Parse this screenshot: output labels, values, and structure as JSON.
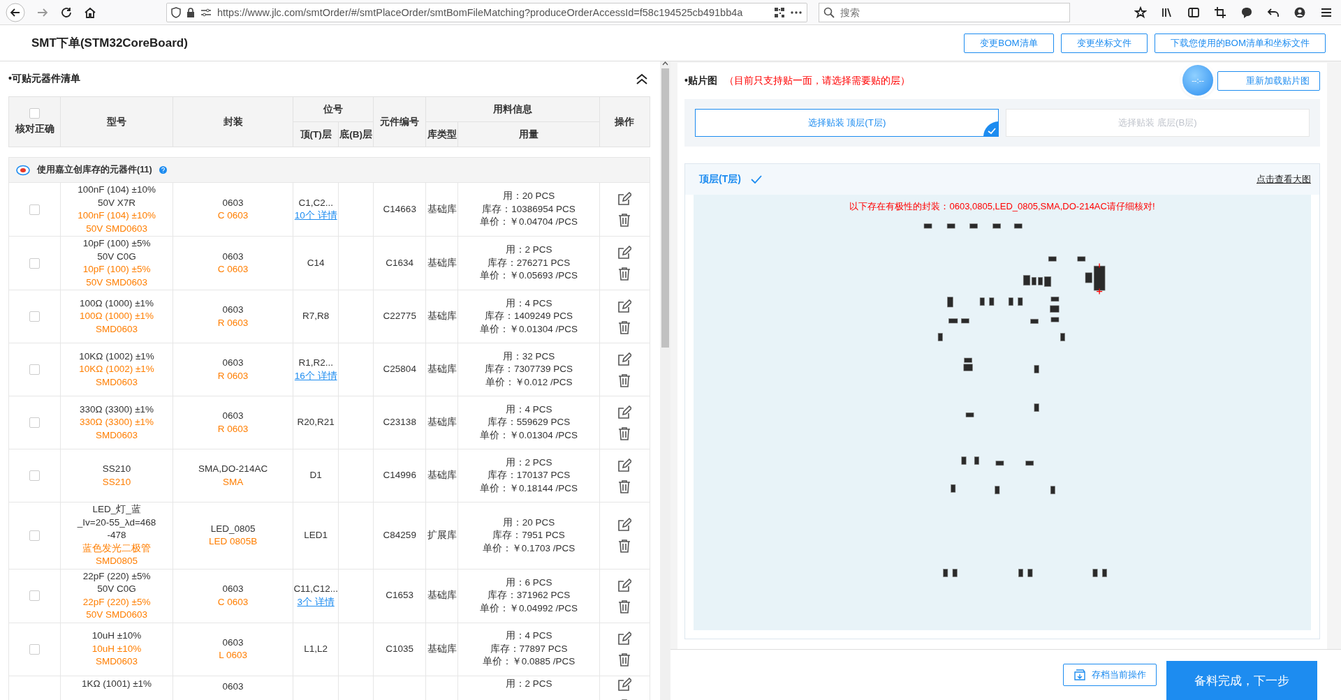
{
  "browser": {
    "url": "https://www.jlc.com/smtOrder/#/smtPlaceOrder/smtBomFileMatching?produceOrderAccessId=f58c194525cb491bb4a",
    "search": {
      "placeholder": "搜索"
    }
  },
  "header": {
    "title": "SMT下单(STM32CoreBoard)",
    "buttons": [
      "变更BOM清单",
      "变更坐标文件",
      "下载您使用的BOM清单和坐标文件"
    ]
  },
  "bom_panel": {
    "title": "•可贴元器件清单",
    "columns": {
      "check": "核对正确",
      "model": "型号",
      "package": "封装",
      "designator": "位号",
      "top": "顶(T)层",
      "bottom": "底(B)层",
      "part_number": "元件编号",
      "material": "用料信息",
      "library": "库类型",
      "usage": "用量",
      "actions": "操作"
    },
    "select_all": {
      "checked": false
    },
    "group": {
      "label": "使用嘉立创库存的元器件(11)"
    },
    "rows": [
      {
        "checked": false,
        "model": [
          "100nF (104) ±10%",
          "50V X7R"
        ],
        "model_match": [
          "100nF (104) ±10%",
          "50V SMD0603"
        ],
        "package": "0603",
        "package_match": "C 0603",
        "top": "C1,C2...",
        "detail": "10个 详情",
        "part_number": "C14663",
        "library": "基础库",
        "usage": "用：20 PCS",
        "stock": "库存：10386954 PCS",
        "price": "单价：￥0.04704 /PCS"
      },
      {
        "checked": false,
        "model": [
          "10pF (100) ±5%",
          "50V C0G"
        ],
        "model_match": [
          "10pF (100) ±5%",
          "50V SMD0603"
        ],
        "package": "0603",
        "package_match": "C 0603",
        "top": "C14",
        "part_number": "C1634",
        "library": "基础库",
        "usage": "用：2 PCS",
        "stock": "库存：276271 PCS",
        "price": "单价：￥0.05693 /PCS"
      },
      {
        "checked": false,
        "model": [
          "100Ω (1000) ±1%"
        ],
        "model_match": [
          "100Ω (1000) ±1%",
          "SMD0603"
        ],
        "package": "0603",
        "package_match": "R 0603",
        "top": "R7,R8",
        "part_number": "C22775",
        "library": "基础库",
        "usage": "用：4 PCS",
        "stock": "库存：1409249 PCS",
        "price": "单价：￥0.01304 /PCS"
      },
      {
        "checked": false,
        "model": [
          "10KΩ (1002) ±1%"
        ],
        "model_match": [
          "10KΩ (1002) ±1%",
          "SMD0603"
        ],
        "package": "0603",
        "package_match": "R 0603",
        "top": "R1,R2...",
        "detail": "16个 详情",
        "part_number": "C25804",
        "library": "基础库",
        "usage": "用：32 PCS",
        "stock": "库存：7307739 PCS",
        "price": "单价：￥0.012 /PCS"
      },
      {
        "checked": false,
        "model": [
          "330Ω (3300) ±1%"
        ],
        "model_match": [
          "330Ω (3300) ±1%",
          "SMD0603"
        ],
        "package": "0603",
        "package_match": "R 0603",
        "top": "R20,R21",
        "part_number": "C23138",
        "library": "基础库",
        "usage": "用：4 PCS",
        "stock": "库存：559629 PCS",
        "price": "单价：￥0.01304 /PCS"
      },
      {
        "checked": false,
        "model": [
          "SS210"
        ],
        "model_match": [
          "SS210"
        ],
        "package": "SMA,DO-214AC",
        "package_match": "SMA",
        "top": "D1",
        "part_number": "C14996",
        "library": "基础库",
        "usage": "用：2 PCS",
        "stock": "库存：170137 PCS",
        "price": "单价：￥0.18144 /PCS"
      },
      {
        "checked": false,
        "model": [
          "LED_灯_蓝",
          "_Iv=20-55_λd=468",
          "-478"
        ],
        "model_match": [
          "蓝色发光二极管",
          "SMD0805"
        ],
        "package": "LED_0805",
        "package_match": "LED 0805B",
        "top": "LED1",
        "part_number": "C84259",
        "library": "扩展库",
        "usage": "用：20 PCS",
        "stock": "库存：7951 PCS",
        "price": "单价：￥0.1703 /PCS"
      },
      {
        "checked": false,
        "model": [
          "22pF (220) ±5%",
          "50V C0G"
        ],
        "model_match": [
          "22pF (220) ±5%",
          "50V SMD0603"
        ],
        "package": "0603",
        "package_match": "C 0603",
        "top": "C11,C12...",
        "detail": "3个 详情",
        "part_number": "C1653",
        "library": "基础库",
        "usage": "用：6 PCS",
        "stock": "库存：371962 PCS",
        "price": "单价：￥0.04992 /PCS"
      },
      {
        "checked": false,
        "model": [
          "10uH ±10%"
        ],
        "model_match": [
          "10uH ±10%",
          "SMD0603"
        ],
        "package": "0603",
        "package_match": "L 0603",
        "top": "L1,L2",
        "part_number": "C1035",
        "library": "基础库",
        "usage": "用：4 PCS",
        "stock": "库存：77897 PCS",
        "price": "单价：￥0.0885 /PCS"
      },
      {
        "model": [
          "1KΩ (1001) ±1%"
        ],
        "package": "0603",
        "usage": "用：2 PCS"
      }
    ]
  },
  "placement_panel": {
    "title": "•贴片图",
    "note": "（目前只支持贴一面，请选择需要贴的层）",
    "reload_button": "重新加载贴片图",
    "widget": "--:--",
    "layers": [
      {
        "label": "选择贴装 顶层(T层)",
        "selected": true
      },
      {
        "label": "选择贴装 底层(B层)",
        "selected": false
      }
    ],
    "view": {
      "title": "顶层(T层)",
      "link": "点击查看大图",
      "warning": "以下存在有极性的封装：0603,0805,LED_0805,SMA,DO-214AC请仔细核对!"
    }
  },
  "footer": {
    "save_button": "存档当前操作",
    "next_button": "备料完成，下一步"
  }
}
